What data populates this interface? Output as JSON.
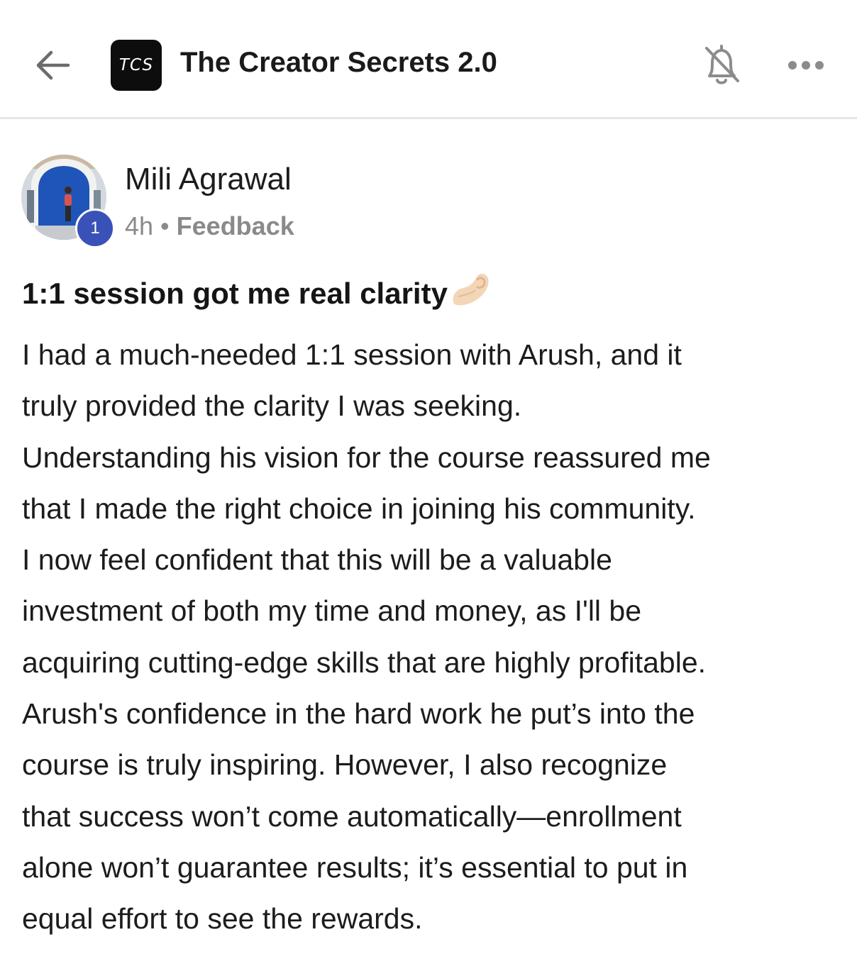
{
  "header": {
    "back_icon": "arrow-left-icon",
    "logo_text": "TCS",
    "group_title": "The Creator Secrets 2.0",
    "notifications_icon": "bell-off-icon",
    "more_icon": "more-horizontal-icon"
  },
  "post": {
    "author": {
      "name": "Mili Agrawal",
      "level": "1",
      "avatar_icon": "avatar-photo"
    },
    "time": "4h",
    "separator": "•",
    "category": "Feedback",
    "title": "1:1 session got me real clarity",
    "title_emoji": "👌",
    "body": "I had a much-needed 1:1 session with Arush, and it\ntruly provided the clarity I was seeking.\nUnderstanding his vision for the course reassured me\nthat I made the right choice in joining his community.\nI now feel confident that this will be a valuable\ninvestment of both my time and money, as I'll be\nacquiring cutting-edge skills that are highly profitable.\nArush's confidence in the hard work he put’s into the\ncourse is truly inspiring. However, I also recognize\nthat success won’t come automatically—enrollment\nalone won’t guarantee results; it’s essential to put in\nequal effort to see the rewards."
  },
  "colors": {
    "level_badge": "#3a51b8",
    "logo_bg": "#0d0d0d",
    "meta_text": "#8a8a8a",
    "divider": "#e6e6e6"
  }
}
